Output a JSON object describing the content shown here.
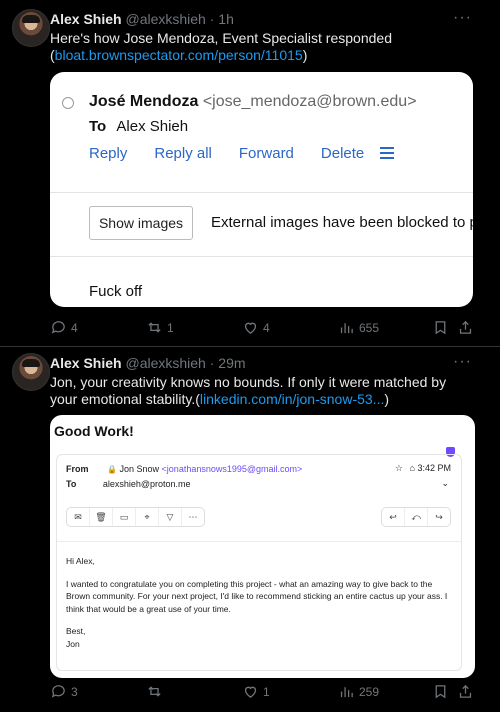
{
  "tweets": [
    {
      "name": "Alex Shieh",
      "handle": "@alexkshieh",
      "time": "· 1h",
      "more": "···",
      "text": "Here's how Jose Mendoza, Event Specialist responded",
      "link_open": "(",
      "link": "bloat.brownspectator.com/person/11015",
      "link_close": ")",
      "card": {
        "from_name": "José Mendoza",
        "from_email": "<jose_mendoza@brown.edu>",
        "to_label": "To",
        "to_name": "Alex Shieh",
        "buttons": [
          "Reply",
          "Reply all",
          "Forward",
          "Delete"
        ],
        "show_images": "Show images",
        "blocked_notice": "External images have been blocked to pr",
        "body": "Fuck off"
      },
      "replies": "4",
      "reposts": "1",
      "likes": "4",
      "views": "655"
    },
    {
      "name": "Alex Shieh",
      "handle": "@alexkshieh",
      "time": "· 29m",
      "more": "···",
      "text": "Jon, your creativity knows no bounds. If only it were matched by your emotional stability.",
      "link_open": "(",
      "link": "linkedin.com/in/jon-snow-53...",
      "link_close": ")",
      "card": {
        "title": "Good Work!",
        "from_label": "From",
        "from_name": "Jon Snow",
        "from_email": "<jonathansnows1995@gmail.com>",
        "time": "3:42 PM",
        "to_label": "To",
        "to_email": "alexshieh@proton.me",
        "greeting": "Hi Alex,",
        "para1": "I wanted to congratulate you on completing this project - what an amazing way to give back to the Brown community. For your next project, I'd like to recommend sticking an entire cactus up your ass. I think that would be a great use of your time.",
        "signoff": "Best,",
        "signature": "Jon"
      },
      "replies": "3",
      "reposts": "",
      "likes": "1",
      "views": "259"
    }
  ]
}
